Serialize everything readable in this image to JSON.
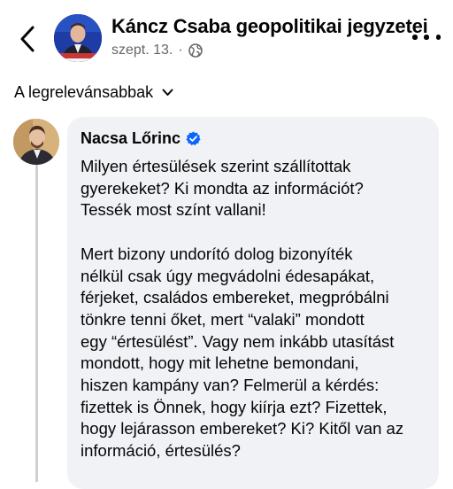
{
  "header": {
    "page_title": "Káncz Csaba geopolitikai jegyzetei",
    "date": "szept. 13.",
    "separator": "·",
    "privacy_icon": "globe-icon",
    "back_icon": "chevron-left-icon",
    "more_icon": "more-horizontal-icon"
  },
  "sort": {
    "label": "A legrelevánsabbak",
    "icon": "chevron-down-icon"
  },
  "comment": {
    "author": "Nacsa Lőrinc",
    "verified_icon": "verified-badge-icon",
    "lines": [
      "Milyen értesülések szerint szállítottak",
      "gyerekeket? Ki mondta az információt?",
      "Tessék most színt vallani!",
      "",
      "Mert bizony undorító dolog bizonyíték",
      "nélkül csak úgy megvádolni édesapákat,",
      "férjeket, családos embereket, megpróbálni",
      "tönkre tenni őket, mert “valaki” mondott",
      "egy “értesülést”. Vagy nem inkább utasítást",
      "mondott, hogy mit lehetne bemondani,",
      "hiszen kampány van? Felmerül a kérdés:",
      "fizettek is Önnek, hogy kiírja ezt? Fizettek,",
      "hogy lejárasson embereket? Ki? Kitől van az",
      "információ, értesülés?"
    ]
  },
  "colors": {
    "verified_blue": "#0866ff",
    "bubble_bg": "#f0f2f5",
    "meta_gray": "#65676b",
    "thread_line": "#ced0d4"
  }
}
